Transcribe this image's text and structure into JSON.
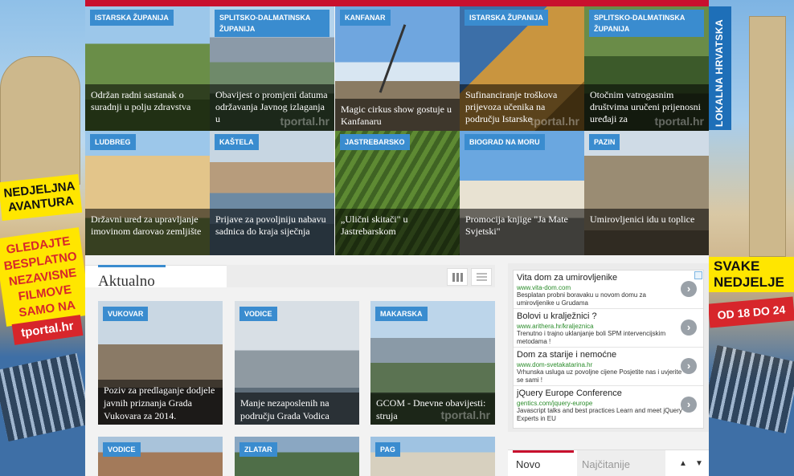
{
  "left_promo": {
    "title": "NEDJELJNA\nAVANTURA",
    "lines": [
      "GLEDAJTE",
      "BESPLATNO",
      "NEZAVISNE",
      "FILMOVE",
      "SAMO NA"
    ],
    "brand": "tportal.hr"
  },
  "right_promo": {
    "title": "SVAKE\nNEDJELJE",
    "time": "OD 18 DO 24"
  },
  "side_banner": "LOKALNA HRVATSKA",
  "watermark": "tportal.hr",
  "grid_tiles": [
    {
      "tag": "ISTARSKA ŽUPANIJA",
      "caption": "Održan radni sastanak o suradnji u polju zdravstva",
      "img": "forest"
    },
    {
      "tag": "SPLITSKO-DALMATINSKA ŽUPANIJA",
      "caption": "Obavijest o promjeni datuma održavanja Javnog izlaganja u",
      "img": "mountain"
    },
    {
      "tag": "KANFANAR",
      "caption": "Magic cirkus show gostuje u Kanfanaru",
      "img": "crane"
    },
    {
      "tag": "ISTARSKA ŽUPANIJA",
      "caption": "Sufinanciranje troškova prijevoza učenika na području Istarske",
      "img": "rocks"
    },
    {
      "tag": "SPLITSKO-DALMATINSKA ŽUPANIJA",
      "caption": "Otočnim vatrogasnim društvima uručeni prijenosni uređaji za",
      "img": "forest"
    },
    {
      "tag": "LUDBREG",
      "caption": "Državni ured za upravljanje imovinom darovao zemljište",
      "img": "palace"
    },
    {
      "tag": "KAŠTELA",
      "caption": "Prijave za povoljniju nabavu sadnica do kraja siječnja",
      "img": "harbor"
    },
    {
      "tag": "JASTREBARSKO",
      "caption": "„Ulični skitači\" u Jastrebarskom",
      "img": "vineyard"
    },
    {
      "tag": "BIOGRAD NA MORU",
      "caption": "Promocija knjige \"Ja Mate Svjetski\"",
      "img": "church"
    },
    {
      "tag": "PAZIN",
      "caption": "Umirovljenici idu u toplice",
      "img": "building"
    }
  ],
  "aktualno": {
    "title": "Aktualno",
    "cards": [
      {
        "tag": "VUKOVAR",
        "caption": "Poziv za predlaganje dodjele javnih priznanja Grada Vukovara za 2014.",
        "img": "people"
      },
      {
        "tag": "VODICE",
        "caption": "Manje nezaposlenih na području Grada Vodica",
        "img": "harbor"
      },
      {
        "tag": "MAKARSKA",
        "caption": "GCOM - Dnevne obavijesti: struja",
        "img": "mountain"
      },
      {
        "tag": "VODICE",
        "caption": "",
        "img": "town"
      },
      {
        "tag": "ZLATAR",
        "caption": "",
        "img": "river"
      },
      {
        "tag": "PAG",
        "caption": "",
        "img": "coast"
      }
    ]
  },
  "ads": [
    {
      "title": "Vita dom za umirovljenike",
      "url": "www.vita-dom.com",
      "desc": "Besplatan probni boravaku u novom domu za umirovljenike u Grudama"
    },
    {
      "title": "Bolovi u kralježnici ?",
      "url": "www.arithera.hr/kraljeznica",
      "desc": "Trenutno i trajno uklanjanje boli SPM intervencijskim metodama !"
    },
    {
      "title": "Dom za starije i nemoćne",
      "url": "www.dom-svetakatarina.hr",
      "desc": "Vrhunska usluga uz povoljne cijene Posjetite nas i uvjerite se sami !"
    },
    {
      "title": "jQuery Europe Conference",
      "url": "gentics.com/jquery-europe",
      "desc": "Javascript talks and best practices Learn and meet jQuery Experts in EU"
    }
  ],
  "ad_go": "›",
  "tabs": {
    "new": "Novo",
    "most_read": "Najčitanije",
    "up": "▲",
    "down": "▼"
  },
  "colors": {
    "accent_red": "#c8102e",
    "tag_blue": "#3a8ccf"
  }
}
